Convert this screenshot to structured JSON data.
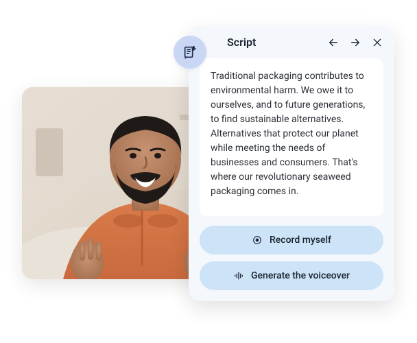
{
  "panel": {
    "title": "Script",
    "script_text": "Traditional packaging contributes to environmental harm. We owe it to ourselves, and to future generations, to find sustainable alternatives. Alternatives that protect our planet while meeting the needs of businesses and consumers. That's where our revolutionary seaweed packaging comes in."
  },
  "actions": {
    "record_label": "Record myself",
    "voiceover_label": "Generate the voiceover"
  },
  "colors": {
    "panel_bg": "#f4f7fb",
    "button_bg": "#cde3f7",
    "badge_bg": "#c9d7f5",
    "text": "#1a2330"
  }
}
